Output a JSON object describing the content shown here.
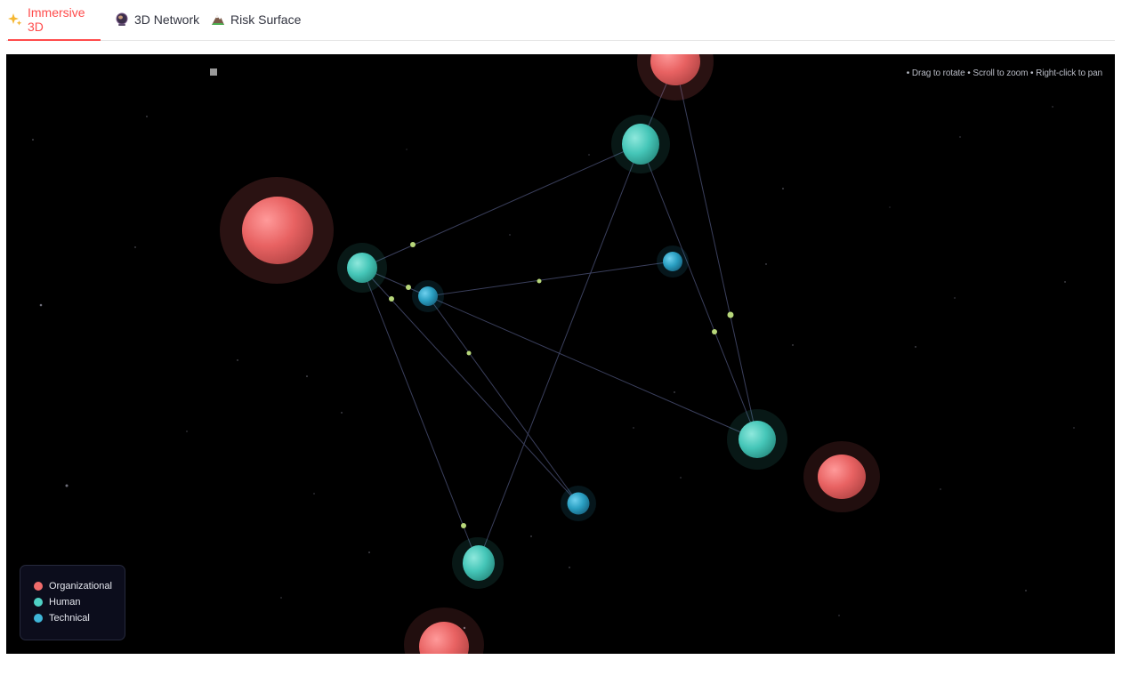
{
  "tabs": [
    {
      "label": "Immersive 3D",
      "icon": "sparkles-icon",
      "active": true
    },
    {
      "label": "3D Network",
      "icon": "globe-icon",
      "active": false
    },
    {
      "label": "Risk Surface",
      "icon": "mountain-icon",
      "active": false
    }
  ],
  "scene": {
    "hint": "•  Drag to rotate • Scroll to zoom • Right-click to pan"
  },
  "legend": {
    "items": [
      {
        "label": "Organizational",
        "color": "#f06b6b"
      },
      {
        "label": "Human",
        "color": "#4fd1c5"
      },
      {
        "label": "Technical",
        "color": "#3fb6d8"
      }
    ]
  },
  "colors": {
    "accent": "#ff4b4b",
    "organizational": "#e86262",
    "human": "#45c6b8",
    "technical": "#2a9fc2",
    "edge": "#3a3f5c",
    "particle": "#b7d77a"
  }
}
